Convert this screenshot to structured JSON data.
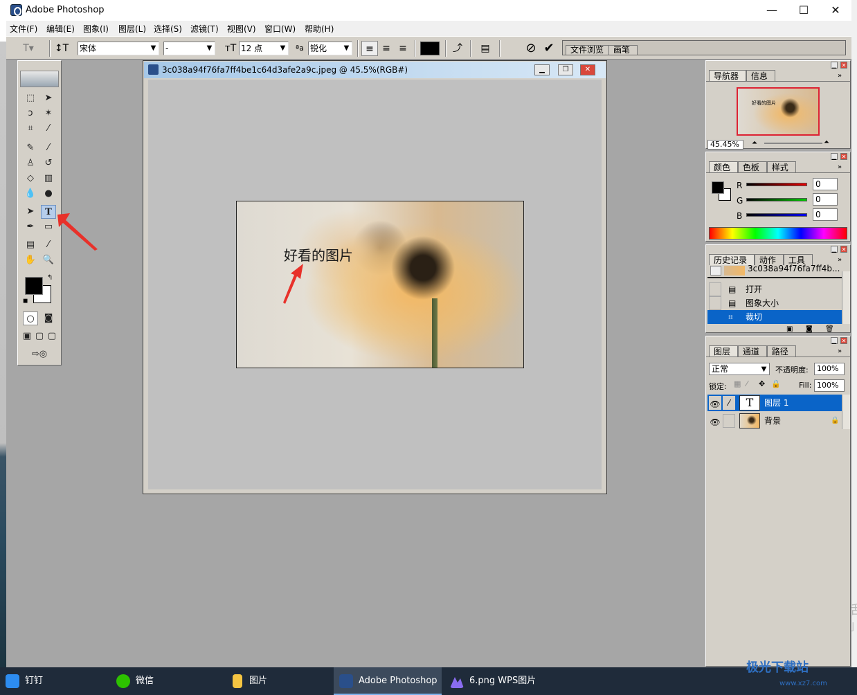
{
  "window": {
    "title": "Adobe Photoshop",
    "minimize": "—",
    "maximize": "☐",
    "close": "✕"
  },
  "menu": [
    "文件(F)",
    "编辑(E)",
    "图象(I)",
    "图层(L)",
    "选择(S)",
    "滤镜(T)",
    "视图(V)",
    "窗口(W)",
    "帮助(H)"
  ],
  "options": {
    "font_family": "宋体",
    "font_style": "-",
    "font_size": "12 点",
    "anti_alias": "锐化",
    "color_swatch": "#000000",
    "palette_tabs": [
      "文件浏览",
      "画笔"
    ]
  },
  "document": {
    "title": "3c038a94f76fa7ff4be1c64d3afe2a9c.jpeg @ 45.5%(RGB#)",
    "text_layer": "好看的图片"
  },
  "panels": {
    "navigator": {
      "tabs": [
        "导航器",
        "信息"
      ],
      "zoom": "45.45%",
      "thumb_text": "好看的图片"
    },
    "color": {
      "tabs": [
        "颜色",
        "色板",
        "样式"
      ],
      "channels": [
        {
          "name": "R",
          "value": "0",
          "color": "#cc0000"
        },
        {
          "name": "G",
          "value": "0",
          "color": "#00aa00"
        },
        {
          "name": "B",
          "value": "0",
          "color": "#0000cc"
        }
      ]
    },
    "history": {
      "tabs": [
        "历史记录",
        "动作",
        "工具"
      ],
      "snapshot": "3c038a94f76fa7ff4b...",
      "items": [
        {
          "label": "打开",
          "selected": false
        },
        {
          "label": "图象大小",
          "selected": false
        },
        {
          "label": "裁切",
          "selected": true
        }
      ]
    },
    "layers": {
      "tabs": [
        "图层",
        "通道",
        "路径"
      ],
      "blend_mode": "正常",
      "opacity_label": "不透明度:",
      "opacity": "100%",
      "lock_label": "锁定:",
      "fill_label": "Fill:",
      "fill": "100%",
      "items": [
        {
          "name": "图层 1",
          "type": "text",
          "selected": true
        },
        {
          "name": "背景",
          "type": "image",
          "selected": false
        }
      ]
    }
  },
  "taskbar": [
    {
      "label": "钉钉",
      "icon": "dingtalk-icon",
      "color": "#2d8cf0"
    },
    {
      "label": "微信",
      "icon": "wechat-icon",
      "color": "#2dc100"
    },
    {
      "label": "图片",
      "icon": "folder-icon",
      "color": "#f5c542"
    },
    {
      "label": "Adobe Photoshop",
      "icon": "photoshop-icon",
      "color": "#2a4f8a",
      "active": true
    },
    {
      "label": "6.png  WPS图片",
      "icon": "wps-picture-icon",
      "color": "#8a6cf0"
    }
  ],
  "watermark": {
    "brand": "极光下载站",
    "site": "www.xz7.com",
    "side_text_1": "激活",
    "side_text_2": "转到"
  },
  "accent": "#0a64c8"
}
